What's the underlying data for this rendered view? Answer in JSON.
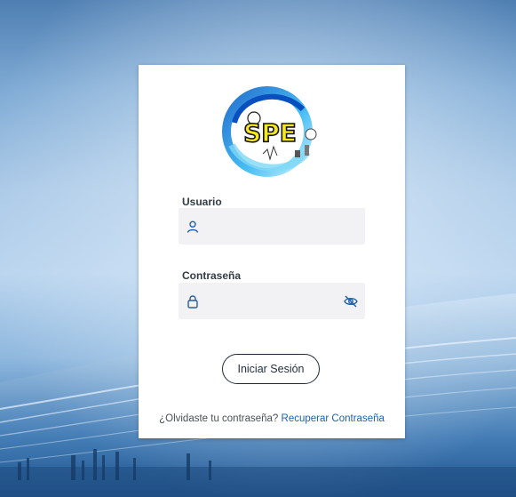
{
  "login": {
    "username_label": "Usuario",
    "username_value": "",
    "password_label": "Contraseña",
    "password_value": "",
    "login_button": "Iniciar Sesión",
    "forgot_text": "¿Olvidaste tu contraseña?",
    "recover_link": "Recuperar Contraseña"
  },
  "logo": {
    "text": "SPE"
  },
  "colors": {
    "accent": "#1f5fa8",
    "input_bg": "#f2f2f4",
    "logo_text_fill": "#f7e81e"
  },
  "icons": {
    "username": "user-icon",
    "password": "lock-icon",
    "toggle_password": "eye-slash-icon"
  }
}
